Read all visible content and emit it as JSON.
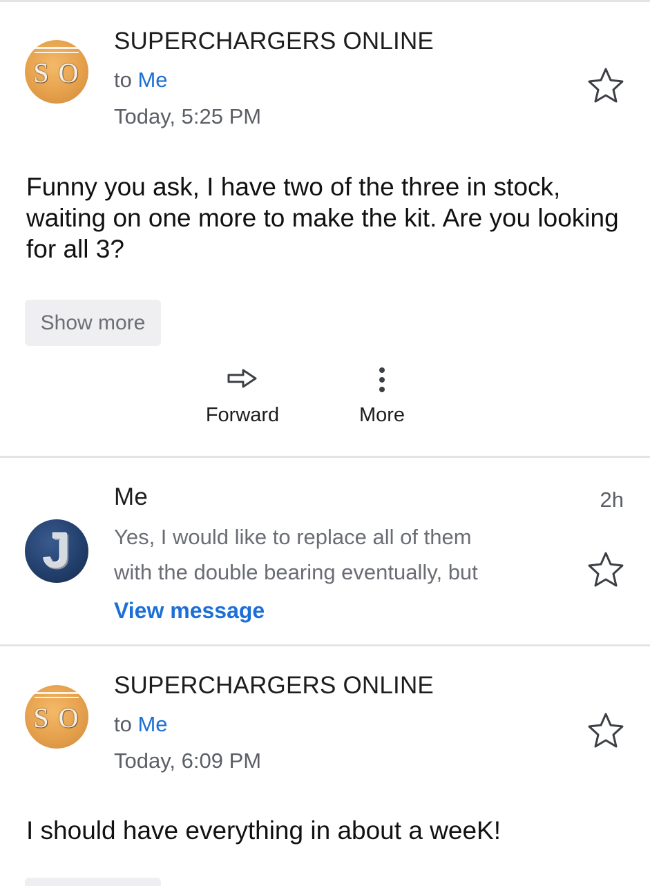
{
  "messages": [
    {
      "sender": "SUPERCHARGERS ONLINE",
      "avatar_initials": "SO",
      "to_prefix": "to",
      "to_name": "Me",
      "time": "Today, 5:25 PM",
      "body": "Funny you ask, I have two of the three in stock, waiting on one more to make the kit.  Are you looking for all 3?",
      "show_more_label": "Show more",
      "actions": [
        {
          "label": "Forward",
          "icon": "forward-arrow-icon"
        },
        {
          "label": "More",
          "icon": "vertical-dots-icon"
        }
      ],
      "starred": false
    },
    {
      "sender": "Me",
      "avatar_initials": "J",
      "ago": "2h",
      "preview_lines": [
        "Yes, I would like to replace all of them",
        "with the double bearing eventually, but"
      ],
      "view_message_label": "View message",
      "starred": false
    },
    {
      "sender": "SUPERCHARGERS ONLINE",
      "avatar_initials": "SO",
      "to_prefix": "to",
      "to_name": "Me",
      "time": "Today, 6:09 PM",
      "body": "I should have everything in about a weeK!",
      "starred": false
    }
  ],
  "colors": {
    "link": "#1c6fd6",
    "divider": "#e4e4e6",
    "button_bg": "#efeff1"
  }
}
